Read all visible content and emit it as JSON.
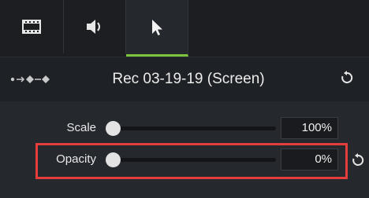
{
  "tabs": [
    {
      "name": "film-strip-icon"
    },
    {
      "name": "speaker-icon"
    },
    {
      "name": "cursor-icon",
      "active": true
    }
  ],
  "header": {
    "title": "Rec 03-19-19 (Screen)",
    "left_icon": "path-dots-icon",
    "reset_icon": "reset-icon"
  },
  "properties": {
    "scale": {
      "label": "Scale",
      "value": "100%",
      "slider_level": 0
    },
    "opacity": {
      "label": "Opacity",
      "value": "0%",
      "slider_level": 0
    }
  },
  "colors": {
    "accent": "#7cc63d",
    "highlight": "#e33d3d",
    "background": "#25282d"
  }
}
